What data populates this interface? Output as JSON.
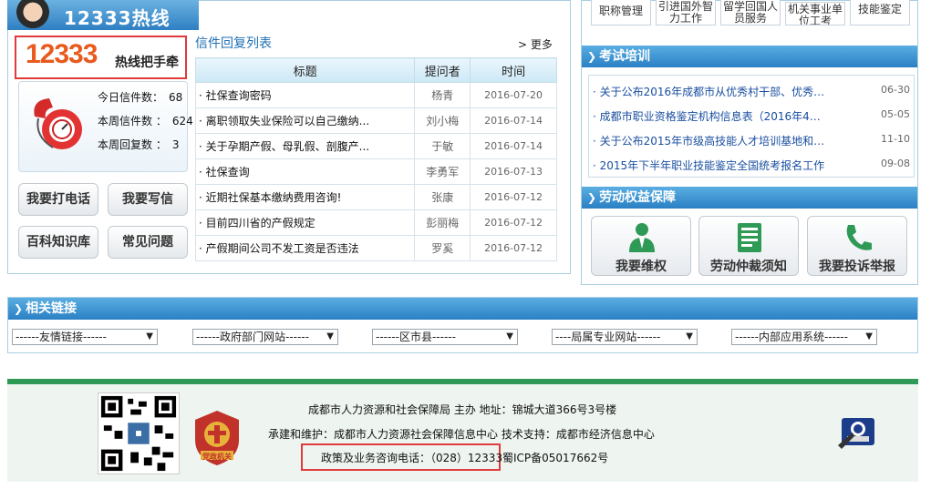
{
  "hotline": {
    "header_title": "12333热线",
    "hand_number": "12333",
    "hand_text": "热线把手牵",
    "stats": [
      {
        "label": "今日信件数：",
        "value": "68"
      },
      {
        "label": "本周信件数 ：",
        "value": "624"
      },
      {
        "label": "本周回复数 ：",
        "value": "3"
      }
    ],
    "buttons": [
      "我要打电话",
      "我要写信",
      "百科知识库",
      "常见问题"
    ]
  },
  "letters": {
    "title": "信件回复列表",
    "more": "> 更多",
    "columns": [
      "标题",
      "提问者",
      "时间"
    ],
    "rows": [
      {
        "title": "· 社保查询密码",
        "asker": "杨青",
        "date": "2016-07-20"
      },
      {
        "title": "· 离职领取失业保险可以自己缴纳...",
        "asker": "刘小梅",
        "date": "2016-07-14"
      },
      {
        "title": "· 关于孕期产假、母乳假、剖腹产...",
        "asker": "于敏",
        "date": "2016-07-14"
      },
      {
        "title": "· 社保查询",
        "asker": "李勇军",
        "date": "2016-07-13"
      },
      {
        "title": "· 近期社保基本缴纳费用咨询!",
        "asker": "张康",
        "date": "2016-07-12"
      },
      {
        "title": "· 目前四川省的产假规定",
        "asker": "彭丽梅",
        "date": "2016-07-12"
      },
      {
        "title": "· 产假期间公司不发工资是否违法",
        "asker": "罗奚",
        "date": "2016-07-12"
      }
    ]
  },
  "top_tabs": [
    "职称管理",
    "引进国外智力工作",
    "留学回国人员服务",
    "机关事业单位工考",
    "技能鉴定"
  ],
  "training": {
    "title": "考试培训",
    "items": [
      {
        "text": "· 关于公布2016年成都市从优秀村干部、优秀…",
        "date": "06-30"
      },
      {
        "text": "· 成都市职业资格鉴定机构信息表（2016年4…",
        "date": "05-05"
      },
      {
        "text": "· 关于公布2015年市级高技能人才培训基地和…",
        "date": "11-10"
      },
      {
        "text": "· 2015年下半年职业技能鉴定全国统考报名工作",
        "date": "09-08"
      }
    ]
  },
  "labor": {
    "title": "劳动权益保障",
    "buttons": [
      {
        "label": "我要维权",
        "icon": "person-icon"
      },
      {
        "label": "劳动仲裁须知",
        "icon": "document-icon"
      },
      {
        "label": "我要投诉举报",
        "icon": "phone-icon"
      }
    ]
  },
  "links": {
    "title": "相关链接",
    "selects": [
      "------友情链接------",
      "------政府部门网站------",
      "------区市县------",
      "----局属专业网站------",
      "------内部应用系统------"
    ]
  },
  "footer": {
    "line1": "成都市人力资源和社会保障局 主办 地址：锦城大道366号3号楼",
    "line2": "承建和维护：成都市人力资源社会保障信息中心 技术支持：成都市经济信息中心",
    "consult": "政策及业务咨询电话：（028）12333",
    "icp": "蜀ICP备05017662号",
    "badge_text": "党政机关"
  },
  "colors": {
    "accent_blue": "#2a80c4",
    "highlight_red": "#e03a3a",
    "footer_green": "#2f9a56"
  }
}
